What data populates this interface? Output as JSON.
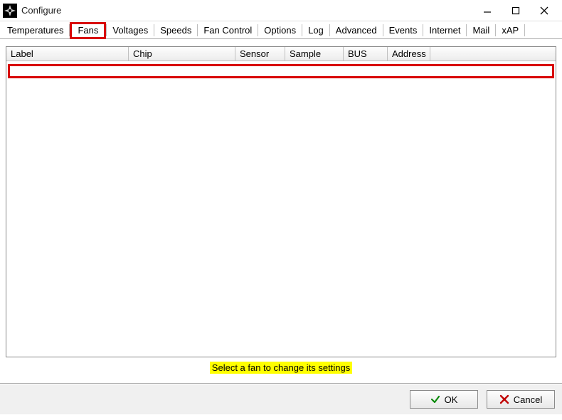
{
  "window": {
    "title": "Configure"
  },
  "tabs": [
    {
      "label": "Temperatures",
      "active": false
    },
    {
      "label": "Fans",
      "active": true
    },
    {
      "label": "Voltages",
      "active": false
    },
    {
      "label": "Speeds",
      "active": false
    },
    {
      "label": "Fan Control",
      "active": false
    },
    {
      "label": "Options",
      "active": false
    },
    {
      "label": "Log",
      "active": false
    },
    {
      "label": "Advanced",
      "active": false
    },
    {
      "label": "Events",
      "active": false
    },
    {
      "label": "Internet",
      "active": false
    },
    {
      "label": "Mail",
      "active": false
    },
    {
      "label": "xAP",
      "active": false
    }
  ],
  "table": {
    "columns": {
      "label": "Label",
      "chip": "Chip",
      "sensor": "Sensor",
      "sample": "Sample",
      "bus": "BUS",
      "address": "Address"
    },
    "rows": []
  },
  "hint": "Select a fan to change its settings",
  "buttons": {
    "ok": "OK",
    "cancel": "Cancel"
  }
}
